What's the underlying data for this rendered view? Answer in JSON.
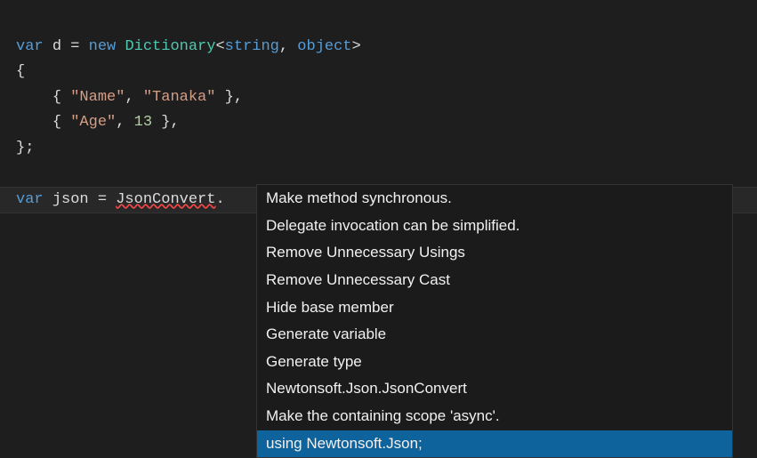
{
  "code": {
    "line1": {
      "kw_var": "var",
      "id_d": "d",
      "eq": "=",
      "kw_new": "new",
      "type_dict": "Dictionary",
      "lt": "<",
      "type_str": "string",
      "comma": ",",
      "type_obj": "object",
      "gt": ">"
    },
    "line2": {
      "brace": "{"
    },
    "line3": {
      "open": "{",
      "str_name": "\"Name\"",
      "comma1": ",",
      "str_tanaka": "\"Tanaka\"",
      "close": "}",
      "comma2": ","
    },
    "line4": {
      "open": "{",
      "str_age": "\"Age\"",
      "comma1": ",",
      "num_13": "13",
      "close": "}",
      "comma2": ","
    },
    "line5": {
      "close": "};"
    },
    "line7": {
      "kw_var": "var",
      "id_json": "json",
      "eq": "=",
      "id_jsonconvert": "JsonConvert",
      "dot": "."
    }
  },
  "colors": {
    "background": "#1e1e1e",
    "keyword": "#569cd6",
    "type": "#4ec9b0",
    "string": "#d69d85",
    "number": "#b5cea8",
    "text": "#dcdcdc",
    "error_underline": "#f44747",
    "menu_bg": "#1b1b1c",
    "menu_selected": "#0e639c"
  },
  "menu": {
    "items": [
      "Make method synchronous.",
      "Delegate invocation can be simplified.",
      "Remove Unnecessary Usings",
      "Remove Unnecessary Cast",
      "Hide base member",
      "Generate variable",
      "Generate type",
      "Newtonsoft.Json.JsonConvert",
      "Make the containing scope 'async'.",
      "using Newtonsoft.Json;"
    ],
    "selected_index": 9
  }
}
